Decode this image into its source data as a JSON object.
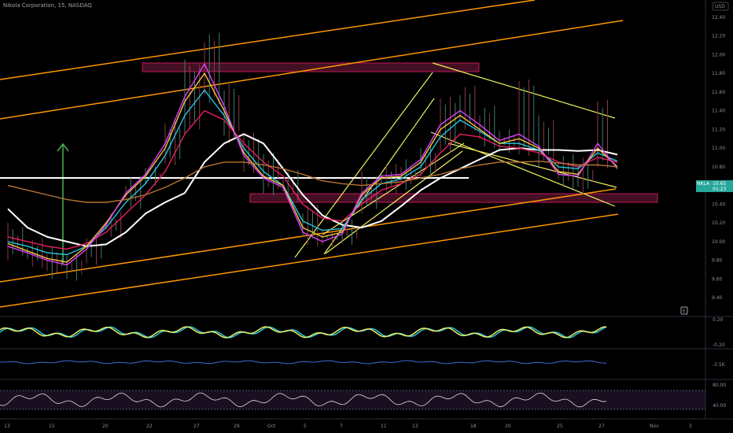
{
  "header": {
    "symbol_title": "Nikola Corporation, 15, NASDAQ",
    "currency": "USD"
  },
  "price_tag": {
    "symbol": "NKLA",
    "price": "10.65",
    "countdown": "01:23",
    "color": "#26a69a"
  },
  "panel_button": "E",
  "chart_data": {
    "type": "line",
    "title": "Nikola Corporation, 15, NASDAQ",
    "ylabel": "USD",
    "x_ticks": [
      "13",
      "15",
      "20",
      "22",
      "27",
      "29",
      "Oct",
      "5",
      "7",
      "11",
      "13",
      "18",
      "20",
      "25",
      "27",
      "Nov",
      "3"
    ],
    "price_axis": [
      9.4,
      9.6,
      9.8,
      10.0,
      10.2,
      10.4,
      10.6,
      10.8,
      11.0,
      11.2,
      11.4,
      11.6,
      11.8,
      12.0,
      12.2,
      12.4
    ],
    "ylim": [
      9.3,
      12.5
    ],
    "series": [
      {
        "color": "#ffffff",
        "values": [
          10.35,
          10.15,
          10.05,
          10.0,
          9.95,
          9.97,
          10.1,
          10.3,
          10.42,
          10.52,
          10.85,
          11.05,
          11.15,
          11.05,
          10.78,
          10.5,
          10.28,
          10.18,
          10.15,
          10.22,
          10.38,
          10.55,
          10.68,
          10.78,
          10.88,
          10.98,
          11.0,
          10.98,
          10.98,
          10.97,
          10.98,
          10.93
        ]
      },
      {
        "color": "#26c6da",
        "values": [
          10.0,
          9.95,
          9.88,
          9.86,
          9.95,
          10.15,
          10.42,
          10.62,
          10.92,
          11.35,
          11.62,
          11.35,
          11.0,
          10.75,
          10.6,
          10.22,
          10.12,
          10.14,
          10.45,
          10.62,
          10.67,
          10.8,
          11.12,
          11.3,
          11.18,
          11.05,
          11.05,
          10.98,
          10.8,
          10.78,
          10.95,
          10.86
        ]
      },
      {
        "color": "#e91e63",
        "values": [
          10.05,
          10.0,
          9.95,
          9.92,
          9.98,
          10.1,
          10.3,
          10.5,
          10.75,
          11.15,
          11.4,
          11.3,
          11.05,
          10.85,
          10.7,
          10.4,
          10.25,
          10.22,
          10.4,
          10.55,
          10.62,
          10.72,
          10.95,
          11.15,
          11.12,
          11.02,
          11.0,
          10.95,
          10.85,
          10.8,
          10.9,
          10.85
        ]
      },
      {
        "color": "#f5c242",
        "values": [
          9.98,
          9.9,
          9.82,
          9.78,
          9.95,
          10.2,
          10.5,
          10.7,
          11.0,
          11.5,
          11.8,
          11.4,
          10.95,
          10.7,
          10.6,
          10.15,
          10.05,
          10.1,
          10.5,
          10.68,
          10.7,
          10.85,
          11.2,
          11.35,
          11.2,
          11.05,
          11.1,
          11.0,
          10.75,
          10.72,
          11.0,
          10.8
        ]
      },
      {
        "color": "#e040fb",
        "values": [
          9.95,
          9.88,
          9.8,
          9.75,
          9.92,
          10.18,
          10.52,
          10.72,
          11.05,
          11.55,
          11.9,
          11.45,
          10.92,
          10.68,
          10.58,
          10.1,
          10.0,
          10.08,
          10.52,
          10.7,
          10.72,
          10.88,
          11.25,
          11.4,
          11.25,
          11.08,
          11.15,
          11.02,
          10.72,
          10.7,
          11.05,
          10.78
        ]
      },
      {
        "color": "#b87333",
        "values": [
          10.6,
          10.55,
          10.5,
          10.45,
          10.42,
          10.42,
          10.45,
          10.5,
          10.58,
          10.68,
          10.8,
          10.85,
          10.85,
          10.82,
          10.78,
          10.72,
          10.65,
          10.62,
          10.6,
          10.62,
          10.64,
          10.68,
          10.72,
          10.78,
          10.82,
          10.85,
          10.85,
          10.86,
          10.84,
          10.82,
          10.82,
          10.8
        ]
      }
    ],
    "price_high": [
      10.2,
      10.05,
      9.95,
      9.9,
      10.05,
      10.35,
      10.7,
      10.85,
      11.3,
      11.95,
      12.25,
      11.7,
      11.2,
      10.95,
      10.8,
      10.4,
      10.2,
      10.25,
      10.75,
      10.85,
      10.88,
      11.05,
      11.55,
      11.7,
      11.45,
      11.25,
      11.75,
      11.35,
      10.95,
      10.9,
      11.55,
      11.0
    ],
    "price_low": [
      9.8,
      9.7,
      9.6,
      9.55,
      9.75,
      10.0,
      10.35,
      10.55,
      10.8,
      11.15,
      11.45,
      11.05,
      10.7,
      10.5,
      10.4,
      9.95,
      9.9,
      9.95,
      10.3,
      10.5,
      10.55,
      10.65,
      10.95,
      11.15,
      11.0,
      10.9,
      10.9,
      10.8,
      10.55,
      10.5,
      10.75,
      10.62
    ],
    "sub_panels": [
      {
        "axis_labels": [
          "0.20",
          "-0.20"
        ]
      },
      {
        "axis_labels": [
          "-3.5K"
        ]
      },
      {
        "axis_labels": [
          "80.00",
          "40.00"
        ]
      }
    ]
  }
}
